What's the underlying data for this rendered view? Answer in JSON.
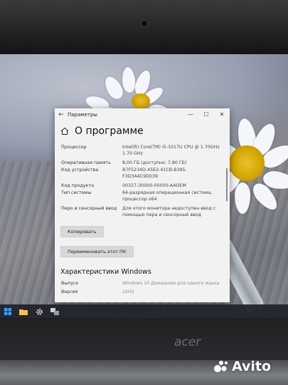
{
  "window": {
    "app_title": "Параметры",
    "back_glyph": "←",
    "minimize_glyph": "—",
    "maximize_glyph": "☐",
    "close_glyph": "✕",
    "page_title": "О программе"
  },
  "device_specs": [
    {
      "key": "Процессор",
      "value": "Intel(R) Core(TM) i5-3317U CPU @ 1.70GHz 1.70 GHz"
    },
    {
      "key": "Оперативная память",
      "value": "8,00 ГБ (доступно: 7,80 ГБ)"
    },
    {
      "key": "Код устройства",
      "value": "B7F5234D-45E2-41CB-B395-F3D3A4C9D039"
    },
    {
      "key": "Код продукта",
      "value": "00327-30000-00000-AAOEM"
    },
    {
      "key": "Тип системы",
      "value": "64-разрядная операционная система, процессор x64"
    },
    {
      "key": "Перо и сенсорный ввод",
      "value": "Для этого монитора недоступен ввод с помощью пера и сенсорный ввод"
    }
  ],
  "buttons": {
    "copy": "Копировать",
    "rename": "Переименовать этот ПК"
  },
  "windows_specs": {
    "title": "Характеристики Windows",
    "rows": [
      {
        "key": "Выпуск",
        "value": "Windows 10 Домашняя для одного языка"
      },
      {
        "key": "Версия",
        "value": "22H2"
      }
    ]
  },
  "laptop": {
    "brand": "acer"
  },
  "watermark": {
    "text": "Avito"
  },
  "colors": {
    "window_bg": "#f2f2f2",
    "button_bg": "#d8d8d8",
    "taskbar_bg": "#1e2028"
  },
  "icons": [
    "home-icon",
    "windows-start-icon",
    "file-explorer-icon",
    "settings-gear-icon",
    "network-app-icon",
    "avito-logo-icon"
  ]
}
